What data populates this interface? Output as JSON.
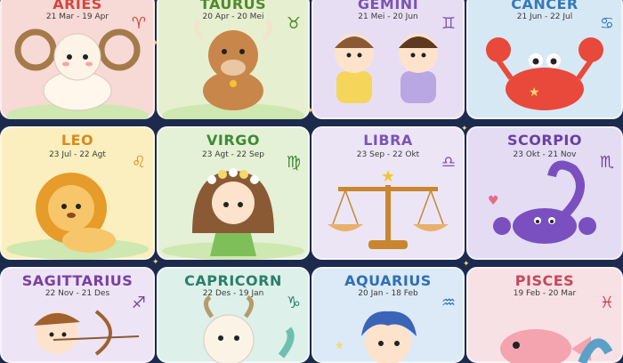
{
  "signs": [
    {
      "name": "ARIES",
      "dates": "21 Mar - 19 Apr",
      "symbol": "♈",
      "bg": "#f7d9d6",
      "title_color": "#d2473f",
      "sym_color": "#d2473f",
      "icon": "sheep-ram-icon"
    },
    {
      "name": "TAURUS",
      "dates": "20 Apr - 20 Mei",
      "symbol": "♉",
      "bg": "#e6efcf",
      "title_color": "#4f8a2b",
      "sym_color": "#4f8a2b",
      "icon": "bull-icon"
    },
    {
      "name": "GEMINI",
      "dates": "21 Mei - 20 Jun",
      "symbol": "♊",
      "bg": "#e8def3",
      "title_color": "#7b55b5",
      "sym_color": "#7b55b5",
      "icon": "twins-icon"
    },
    {
      "name": "CANCER",
      "dates": "21 Jun - 22 Jul",
      "symbol": "♋",
      "bg": "#d7e8f5",
      "title_color": "#3579b8",
      "sym_color": "#3579b8",
      "icon": "crab-icon"
    },
    {
      "name": "LEO",
      "dates": "23 Jul - 22 Agt",
      "symbol": "♌",
      "bg": "#fbefbf",
      "title_color": "#d98a1c",
      "sym_color": "#d98a1c",
      "icon": "lion-icon"
    },
    {
      "name": "VIRGO",
      "dates": "23 Agt - 22 Sep",
      "symbol": "♍",
      "bg": "#e4f1d6",
      "title_color": "#3f8a35",
      "sym_color": "#3f8a35",
      "icon": "maiden-icon"
    },
    {
      "name": "LIBRA",
      "dates": "23 Sep - 22 Okt",
      "symbol": "♎",
      "bg": "#ece5f6",
      "title_color": "#7b55b5",
      "sym_color": "#7b55b5",
      "icon": "scales-icon"
    },
    {
      "name": "SCORPIO",
      "dates": "23 Okt - 21 Nov",
      "symbol": "♏",
      "bg": "#e3dcf3",
      "title_color": "#6a3fa3",
      "sym_color": "#6a3fa3",
      "icon": "scorpion-icon"
    },
    {
      "name": "SAGITTARIUS",
      "dates": "22 Nov - 21 Des",
      "symbol": "♐",
      "bg": "#ede4f6",
      "title_color": "#7a3fa3",
      "sym_color": "#7a3fa3",
      "icon": "archer-icon"
    },
    {
      "name": "CAPRICORN",
      "dates": "22 Des - 19 Jan",
      "symbol": "♑",
      "bg": "#ddf0ea",
      "title_color": "#2b7f6a",
      "sym_color": "#2b7f6a",
      "icon": "goat-icon"
    },
    {
      "name": "AQUARIUS",
      "dates": "20 Jan - 18 Feb",
      "symbol": "♒",
      "bg": "#dce9f6",
      "title_color": "#2f6fb5",
      "sym_color": "#2f6fb5",
      "icon": "water-bearer-icon"
    },
    {
      "name": "PISCES",
      "dates": "19 Feb - 20 Mar",
      "symbol": "♓",
      "bg": "#f8e1e4",
      "title_color": "#c6475a",
      "sym_color": "#c6475a",
      "icon": "fish-icon"
    }
  ]
}
